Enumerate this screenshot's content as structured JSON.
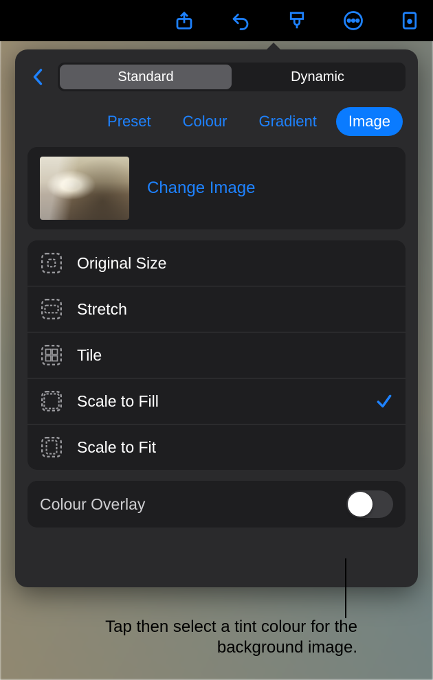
{
  "segmented": {
    "standard": "Standard",
    "dynamic": "Dynamic",
    "selected": "standard"
  },
  "pills": {
    "preset": "Preset",
    "colour": "Colour",
    "gradient": "Gradient",
    "image": "Image",
    "active": "image"
  },
  "change_image": "Change Image",
  "scale_options": [
    {
      "key": "original",
      "label": "Original Size",
      "selected": false
    },
    {
      "key": "stretch",
      "label": "Stretch",
      "selected": false
    },
    {
      "key": "tile",
      "label": "Tile",
      "selected": false
    },
    {
      "key": "scalefill",
      "label": "Scale to Fill",
      "selected": true
    },
    {
      "key": "scalefit",
      "label": "Scale to Fit",
      "selected": false
    }
  ],
  "overlay": {
    "label": "Colour Overlay",
    "on": false
  },
  "callout": "Tap then select a tint colour for the background image."
}
